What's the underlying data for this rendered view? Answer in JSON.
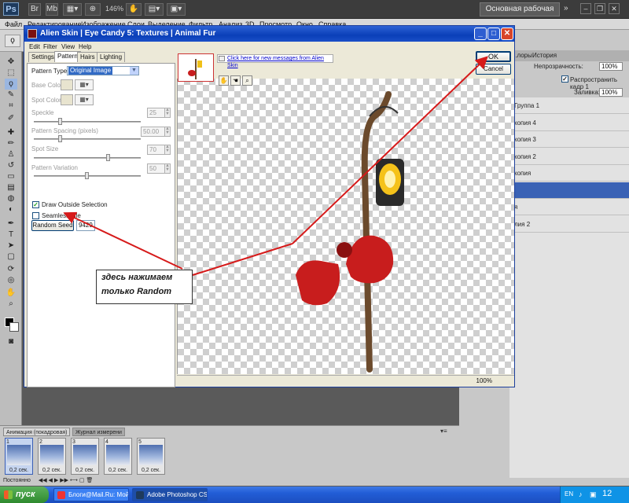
{
  "photoshop": {
    "logo": "Ps",
    "zoom": "146%",
    "workspace": "Основная рабочая среда",
    "menu": [
      "Файл",
      "Редактирование",
      "Изображение",
      "Слои",
      "Выделение",
      "Фильтр",
      "Анализ",
      "3D",
      "Просмотр",
      "Окно",
      "Справка"
    ],
    "layers_tabs": [
      "..лоры",
      "История"
    ],
    "opacity_label": "Непрозрачность:",
    "opacity_value": "100%",
    "propagate_label": "Распространить кадр 1",
    "fill_label": "Заливка:",
    "fill_value": "100%",
    "layers": [
      {
        "name": "Группа 1",
        "selected": false
      },
      {
        "name": "копия 4",
        "selected": false
      },
      {
        "name": "копия 3",
        "selected": false
      },
      {
        "name": "копия 2",
        "selected": false
      },
      {
        "name": "копия",
        "selected": false
      },
      {
        "name": "",
        "selected": true
      },
      {
        "name": "я",
        "selected": false
      },
      {
        "name": "лия 2",
        "selected": false
      }
    ]
  },
  "dialog": {
    "title": "Alien Skin | Eye Candy 5: Textures | Animal Fur",
    "menu": [
      "Edit",
      "Filter",
      "View",
      "Help"
    ],
    "tabs": [
      {
        "label": "Settings",
        "active": false
      },
      {
        "label": "Pattern",
        "active": true
      },
      {
        "label": "Hairs",
        "active": false
      },
      {
        "label": "Lighting",
        "active": false
      }
    ],
    "pattern_type_label": "Pattern Type:",
    "pattern_type_value": "Original Image",
    "base_color_label": "Base Color",
    "spot_color_label": "Spot Color",
    "speckle_label": "Speckle",
    "speckle_value": "25",
    "speckle_level": 0.25,
    "pattern_spacing_label": "Pattern Spacing (pixels)",
    "pattern_spacing_value": "50.00",
    "pattern_spacing_level": 0.25,
    "spot_size_label": "Spot Size",
    "spot_size_value": "70",
    "spot_size_level": 0.7,
    "pattern_variation_label": "Pattern Variation",
    "pattern_variation_value": "50",
    "pattern_variation_level": 0.5,
    "draw_outside_label": "Draw Outside Selection",
    "draw_outside_checked": true,
    "seamless_label": "Seamless Tile",
    "seamless_checked": false,
    "random_seed_label": "Random Seed",
    "random_seed_value": "9429",
    "message_link": "Click here for new messages from Alien Skin",
    "ok_label": "OK",
    "cancel_label": "Cancel",
    "zoom_status": "100%"
  },
  "annotation": {
    "line1": "здесь нажимаем",
    "line2": "только Random",
    "color": "#d61a1a"
  },
  "animation": {
    "tabs": [
      "Анимация (покадровая)",
      "Журнал измерени"
    ],
    "frames": [
      {
        "num": "1",
        "time": "0,2 сек.",
        "selected": true
      },
      {
        "num": "2",
        "time": "0,2 сек.",
        "selected": false
      },
      {
        "num": "3",
        "time": "0,2 сек.",
        "selected": false
      },
      {
        "num": "4",
        "time": "0,2 сек.",
        "selected": false
      },
      {
        "num": "5",
        "time": "0,2 сек.",
        "selected": false
      }
    ],
    "loop_label": "Постоянно"
  },
  "taskbar": {
    "start_label": "пуск",
    "tasks": [
      {
        "label": "Блоги@Mail.Ru: Мой ...",
        "active": false
      },
      {
        "label": "Adobe Photoshop CS...",
        "active": true
      }
    ],
    "lang": "EN",
    "clock": "12"
  }
}
